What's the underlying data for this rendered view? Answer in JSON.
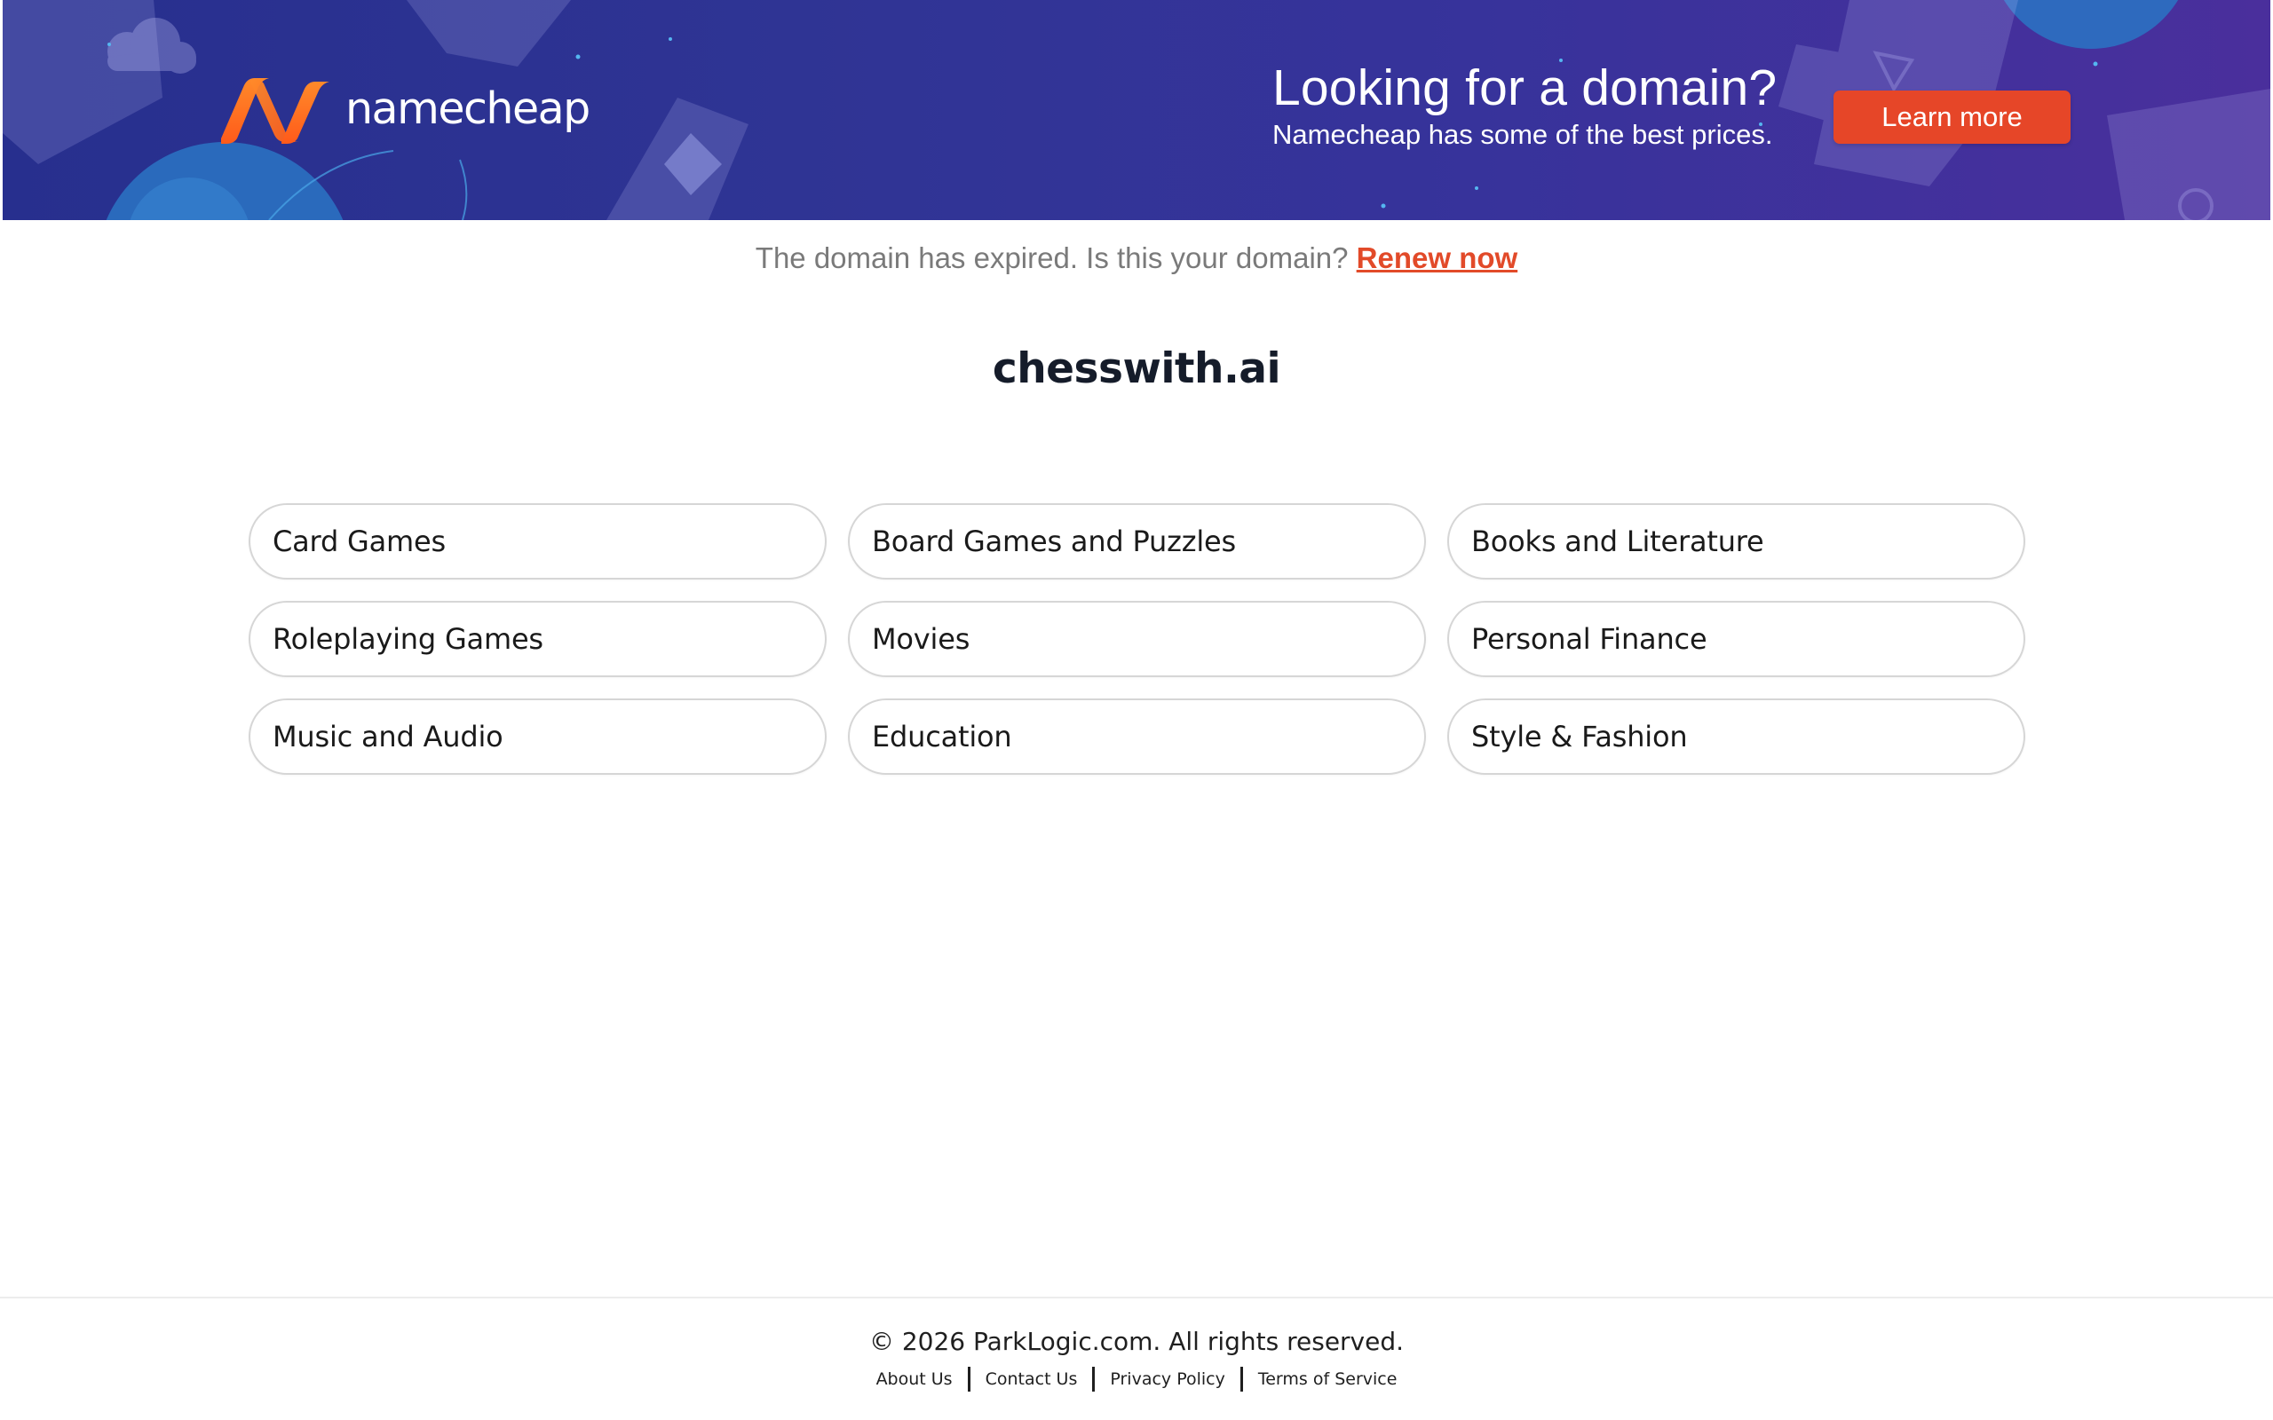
{
  "banner": {
    "brand_name": "namecheap",
    "headline": "Looking for a domain?",
    "subheadline": "Namecheap has some of the best prices.",
    "cta_label": "Learn more",
    "colors": {
      "background_start": "#272f8e",
      "background_end": "#4a2f9c",
      "logo_orange": "#ff6a1a",
      "cta": "#e64628"
    }
  },
  "notice": {
    "text": "The domain has expired. Is this your domain?",
    "link_label": "Renew now",
    "link_color": "#e24a29"
  },
  "domain": {
    "name": "chesswith.ai"
  },
  "categories": [
    "Card Games",
    "Board Games and Puzzles",
    "Books and Literature",
    "Roleplaying Games",
    "Movies",
    "Personal Finance",
    "Music and Audio",
    "Education",
    "Style & Fashion"
  ],
  "footer": {
    "copyright": "© 2026 ParkLogic.com. All rights reserved.",
    "links": [
      "About Us",
      "Contact Us",
      "Privacy Policy",
      "Terms of Service"
    ]
  }
}
